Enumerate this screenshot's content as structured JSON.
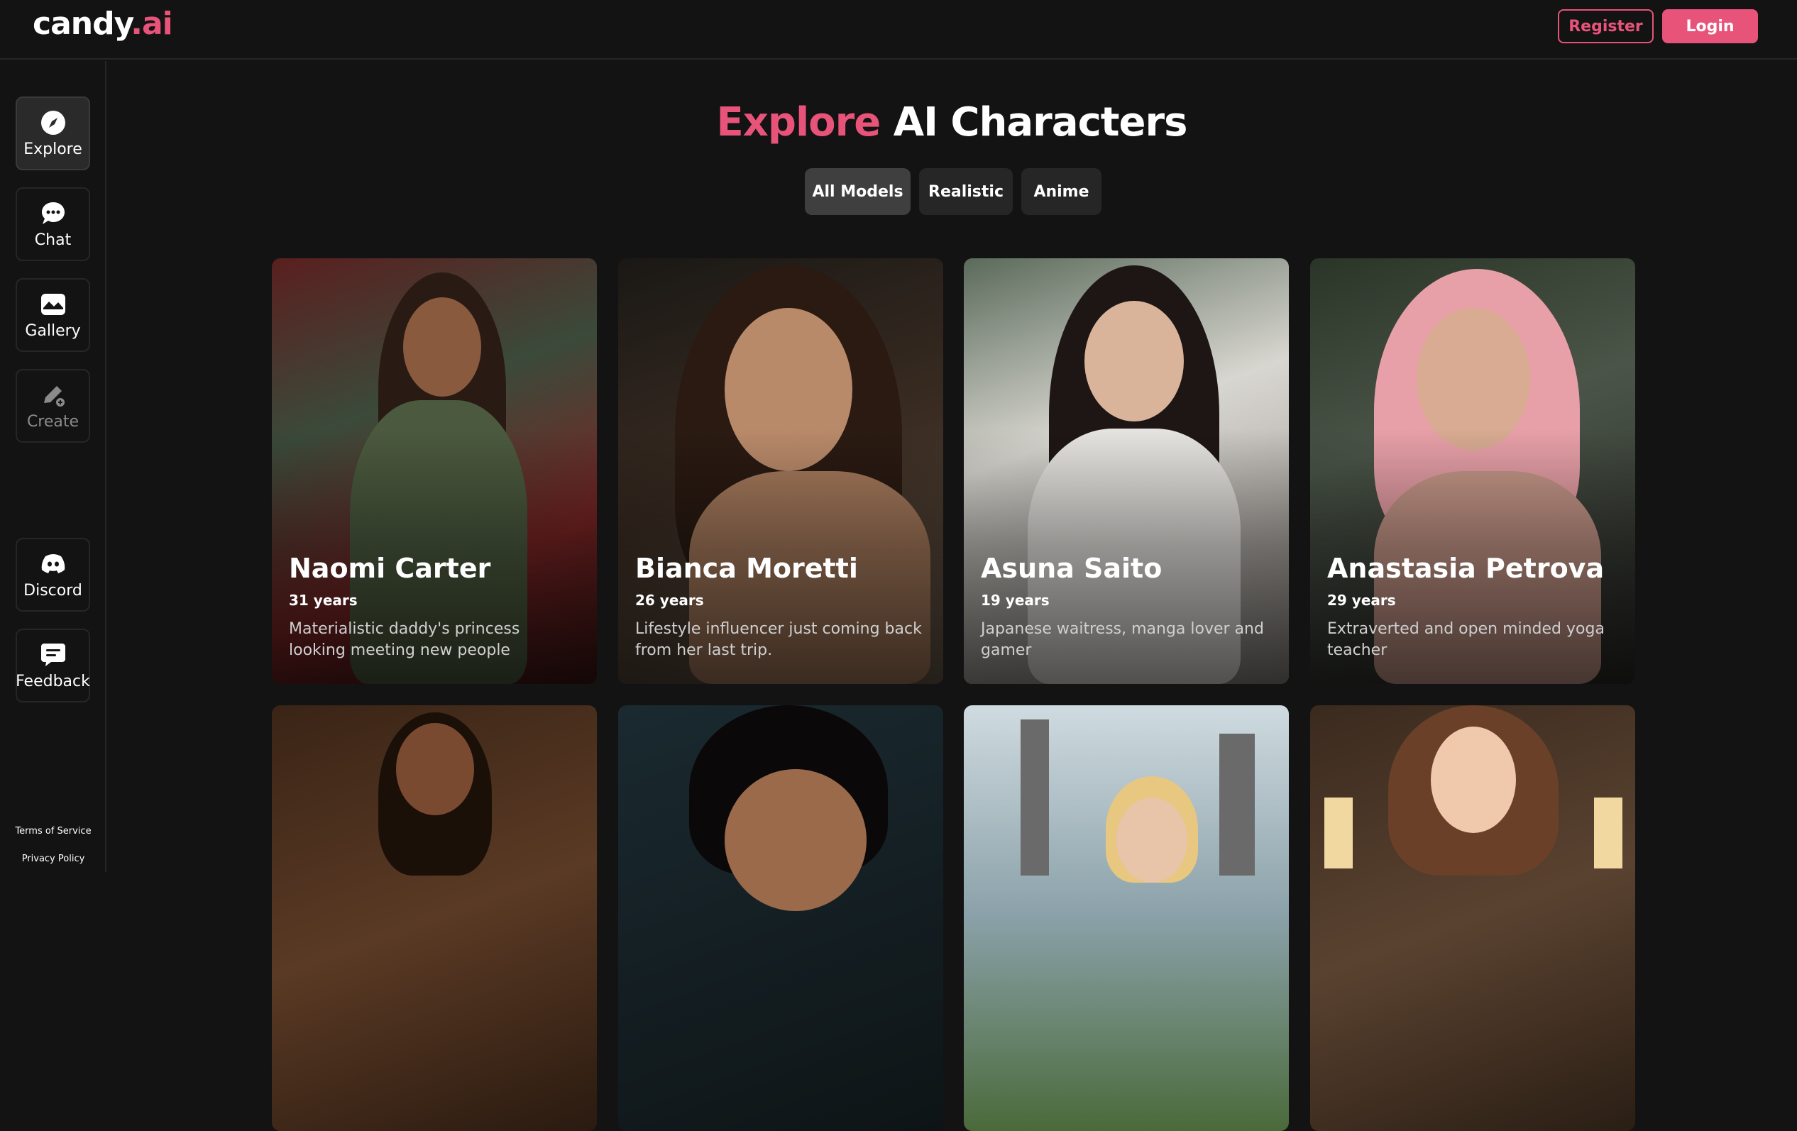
{
  "header": {
    "logo_main": "candy",
    "logo_accent": ".ai",
    "register_label": "Register",
    "login_label": "Login"
  },
  "sidebar": {
    "items": [
      {
        "label": "Explore",
        "icon": "compass-icon"
      },
      {
        "label": "Chat",
        "icon": "chat-bubble-icon"
      },
      {
        "label": "Gallery",
        "icon": "image-icon"
      },
      {
        "label": "Create",
        "icon": "pencil-icon"
      },
      {
        "label": "Discord",
        "icon": "discord-icon"
      },
      {
        "label": "Feedback",
        "icon": "feedback-icon"
      }
    ],
    "terms": "Terms of Service",
    "privacy": "Privacy Policy"
  },
  "main": {
    "title_accent": "Explore",
    "title_rest": "AI Characters",
    "filters": [
      "All Models",
      "Realistic",
      "Anime"
    ]
  },
  "characters": [
    {
      "name": "Naomi Carter",
      "age": "31 years",
      "desc": "Materialistic daddy's princess looking meeting new people"
    },
    {
      "name": "Bianca Moretti",
      "age": "26 years",
      "desc": "Lifestyle influencer just coming back from her last trip."
    },
    {
      "name": "Asuna Saito",
      "age": "19 years",
      "desc": "Japanese waitress, manga lover and gamer"
    },
    {
      "name": "Anastasia Petrova",
      "age": "29 years",
      "desc": "Extraverted and open minded yoga teacher"
    }
  ],
  "colors": {
    "accent": "#e8537a",
    "background": "#131313"
  }
}
